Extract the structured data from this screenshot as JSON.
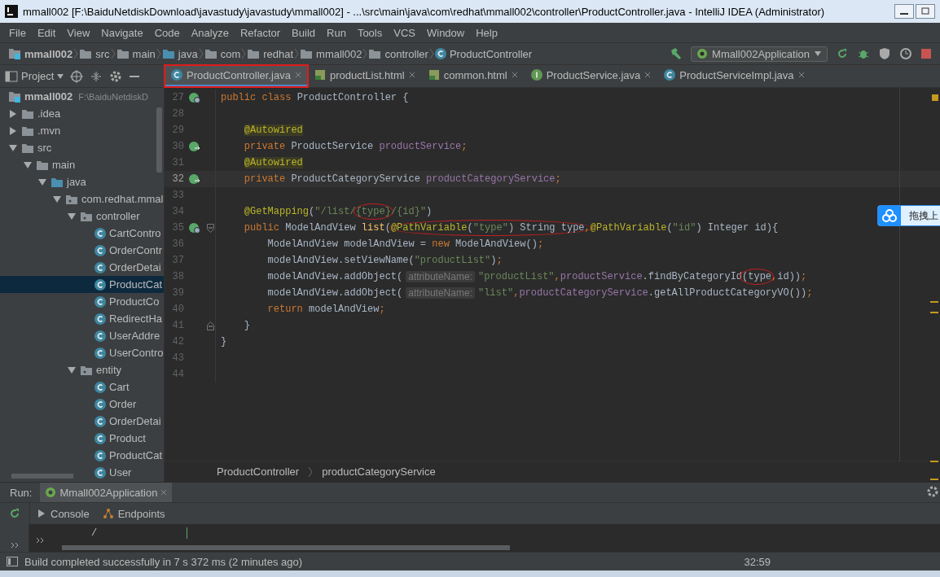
{
  "window": {
    "title": "mmall002 [F:\\BaiduNetdiskDownload\\javastudy\\javastudy\\mmall002] - ...\\src\\main\\java\\com\\redhat\\mmall002\\controller\\ProductController.java - IntelliJ IDEA (Administrator)"
  },
  "menu": [
    "File",
    "Edit",
    "View",
    "Navigate",
    "Code",
    "Analyze",
    "Refactor",
    "Build",
    "Run",
    "Tools",
    "VCS",
    "Window",
    "Help"
  ],
  "breadcrumbs": [
    {
      "label": "mmall002",
      "kind": "project"
    },
    {
      "label": "src",
      "kind": "folder"
    },
    {
      "label": "main",
      "kind": "folder"
    },
    {
      "label": "java",
      "kind": "source"
    },
    {
      "label": "com",
      "kind": "folder"
    },
    {
      "label": "redhat",
      "kind": "folder"
    },
    {
      "label": "mmall002",
      "kind": "folder"
    },
    {
      "label": "controller",
      "kind": "folder"
    },
    {
      "label": "ProductController",
      "kind": "class"
    }
  ],
  "run_config": "Mmall002Application",
  "project_tool": "Project",
  "tabs": [
    {
      "label": "ProductController.java",
      "kind": "class",
      "selected": true,
      "boxed": true
    },
    {
      "label": "productList.html",
      "kind": "html",
      "selected": false,
      "boxed": false
    },
    {
      "label": "common.html",
      "kind": "html",
      "selected": false,
      "boxed": false
    },
    {
      "label": "ProductService.java",
      "kind": "interface",
      "selected": false,
      "boxed": false
    },
    {
      "label": "ProductServiceImpl.java",
      "kind": "class",
      "selected": false,
      "boxed": false
    }
  ],
  "tree": [
    {
      "label": "mmall002",
      "kind": "project",
      "path": "F:\\BaiduNetdiskD",
      "selected": false,
      "children": [
        {
          "label": ".idea",
          "kind": "folder",
          "selected": false,
          "expanded": false
        },
        {
          "label": ".mvn",
          "kind": "folder",
          "selected": false,
          "expanded": false
        },
        {
          "label": "src",
          "kind": "folder",
          "selected": false,
          "expanded": true,
          "children": [
            {
              "label": "main",
              "kind": "folder",
              "selected": false,
              "expanded": true,
              "children": [
                {
                  "label": "java",
                  "kind": "source",
                  "selected": false,
                  "expanded": true,
                  "children": [
                    {
                      "label": "com.redhat.mmal",
                      "kind": "package",
                      "selected": false,
                      "expanded": true,
                      "children": [
                        {
                          "label": "controller",
                          "kind": "package",
                          "selected": false,
                          "expanded": true,
                          "children": [
                            {
                              "label": "CartContro",
                              "kind": "class",
                              "selected": false
                            },
                            {
                              "label": "OrderContr",
                              "kind": "class",
                              "selected": false
                            },
                            {
                              "label": "OrderDetai",
                              "kind": "class",
                              "selected": false
                            },
                            {
                              "label": "ProductCat",
                              "kind": "class",
                              "selected": true
                            },
                            {
                              "label": "ProductCo",
                              "kind": "class",
                              "selected": false
                            },
                            {
                              "label": "RedirectHa",
                              "kind": "class",
                              "selected": false
                            },
                            {
                              "label": "UserAddre",
                              "kind": "class",
                              "selected": false
                            },
                            {
                              "label": "UserContro",
                              "kind": "class",
                              "selected": false
                            }
                          ]
                        },
                        {
                          "label": "entity",
                          "kind": "package",
                          "selected": false,
                          "expanded": true,
                          "children": [
                            {
                              "label": "Cart",
                              "kind": "class",
                              "selected": false
                            },
                            {
                              "label": "Order",
                              "kind": "class",
                              "selected": false
                            },
                            {
                              "label": "OrderDetai",
                              "kind": "class",
                              "selected": false
                            },
                            {
                              "label": "Product",
                              "kind": "class",
                              "selected": false
                            },
                            {
                              "label": "ProductCat",
                              "kind": "class",
                              "selected": false
                            },
                            {
                              "label": "User",
                              "kind": "class",
                              "selected": false
                            }
                          ]
                        }
                      ]
                    }
                  ]
                }
              ]
            }
          ]
        }
      ]
    }
  ],
  "code": [
    {
      "number": "27",
      "gutter": {
        "kind": "web"
      },
      "current": false,
      "tokens": [
        {
          "kind": "kw",
          "text": "public class "
        },
        {
          "kind": "plain",
          "text": "ProductController {"
        }
      ]
    },
    {
      "number": "28",
      "current": false
    },
    {
      "number": "29",
      "current": false,
      "tokens": [
        {
          "kind": "ann",
          "text": "    @Autowired"
        }
      ]
    },
    {
      "number": "30",
      "gutter": {
        "kind": "bean"
      },
      "current": false,
      "tokens": [
        {
          "kind": "kw",
          "text": "    private "
        },
        {
          "kind": "plain",
          "text": "ProductService "
        },
        {
          "kind": "field",
          "text": "productService"
        },
        {
          "kind": "kw",
          "text": ";"
        }
      ]
    },
    {
      "number": "31",
      "current": false,
      "tokens": [
        {
          "kind": "ann",
          "text": "    @Autowired"
        }
      ]
    },
    {
      "number": "32",
      "gutter": {
        "kind": "bean"
      },
      "current": true,
      "tokens": [
        {
          "kind": "kw",
          "text": "    private "
        },
        {
          "kind": "plain",
          "text": "ProductCategoryService "
        },
        {
          "kind": "field",
          "text": "productCategoryService"
        },
        {
          "kind": "kw",
          "text": ";"
        }
      ]
    },
    {
      "number": "33",
      "current": false
    },
    {
      "number": "34",
      "current": false,
      "tokens": [
        {
          "kind": "annplain",
          "text": "    @GetMapping"
        },
        {
          "kind": "plain",
          "text": "("
        },
        {
          "kind": "str",
          "text": "\"/list/"
        },
        {
          "kind": "str",
          "text": "{type}",
          "circled": true
        },
        {
          "kind": "str",
          "text": "/{id}\""
        },
        {
          "kind": "plain",
          "text": ")"
        }
      ]
    },
    {
      "number": "35",
      "gutter": {
        "kind": "web"
      },
      "fold": {
        "kind": "open"
      },
      "current": false,
      "tokens": [
        {
          "kind": "kw",
          "text": "    public "
        },
        {
          "kind": "plain",
          "text": "ModelAndView "
        },
        {
          "kind": "fn",
          "text": "list"
        },
        {
          "kind": "plain",
          "text": "("
        },
        {
          "kind": "group",
          "circled": true,
          "parts": [
            {
              "kind": "annplain",
              "text": "@PathVariable"
            },
            {
              "kind": "plain",
              "text": "("
            },
            {
              "kind": "str",
              "text": "\"type\""
            },
            {
              "kind": "plain",
              "text": ") String type"
            },
            {
              "kind": "kw",
              "text": ","
            }
          ]
        },
        {
          "kind": "annplain",
          "text": "@PathVariable"
        },
        {
          "kind": "plain",
          "text": "("
        },
        {
          "kind": "str",
          "text": "\"id\""
        },
        {
          "kind": "plain",
          "text": ") Integer id){"
        }
      ]
    },
    {
      "number": "36",
      "current": false,
      "tokens": [
        {
          "kind": "plain",
          "text": "        ModelAndView modelAndView = "
        },
        {
          "kind": "kw",
          "text": "new "
        },
        {
          "kind": "plain",
          "text": "ModelAndView()"
        },
        {
          "kind": "kw",
          "text": ";"
        }
      ]
    },
    {
      "number": "37",
      "current": false,
      "tokens": [
        {
          "kind": "plain",
          "text": "        modelAndView.setViewName("
        },
        {
          "kind": "str",
          "text": "\"productList\""
        },
        {
          "kind": "plain",
          "text": ")"
        },
        {
          "kind": "kw",
          "text": ";"
        }
      ]
    },
    {
      "number": "38",
      "current": false,
      "tokens": [
        {
          "kind": "plain",
          "text": "        modelAndView.addObject("
        },
        {
          "kind": "hint",
          "text": "attributeName:"
        },
        {
          "kind": "str",
          "text": "\"productList\""
        },
        {
          "kind": "kw",
          "text": ","
        },
        {
          "kind": "field",
          "text": "productService"
        },
        {
          "kind": "plain",
          "text": ".findByCategoryId"
        },
        {
          "kind": "plain",
          "text": "(type",
          "circled": true
        },
        {
          "kind": "kw",
          "text": ","
        },
        {
          "kind": "plain",
          "text": "id))"
        },
        {
          "kind": "kw",
          "text": ";"
        }
      ]
    },
    {
      "number": "39",
      "current": false,
      "tokens": [
        {
          "kind": "plain",
          "text": "        modelAndView.addObject("
        },
        {
          "kind": "hint",
          "text": "attributeName:"
        },
        {
          "kind": "str",
          "text": "\"list\""
        },
        {
          "kind": "kw",
          "text": ","
        },
        {
          "kind": "field",
          "text": "productCategoryService"
        },
        {
          "kind": "plain",
          "text": ".getAllProductCategoryVO())"
        },
        {
          "kind": "kw",
          "text": ";"
        }
      ]
    },
    {
      "number": "40",
      "current": false,
      "tokens": [
        {
          "kind": "kw",
          "text": "        return "
        },
        {
          "kind": "plain",
          "text": "modelAndView"
        },
        {
          "kind": "kw",
          "text": ";"
        }
      ]
    },
    {
      "number": "41",
      "fold": {
        "kind": "close"
      },
      "current": false,
      "tokens": [
        {
          "kind": "plain",
          "text": "    }"
        }
      ]
    },
    {
      "number": "42",
      "current": false,
      "tokens": [
        {
          "kind": "plain",
          "text": "}"
        }
      ]
    },
    {
      "number": "43",
      "current": false
    },
    {
      "number": "44",
      "current": false
    }
  ],
  "editor_breadcrumbs": [
    "ProductController",
    "productCategoryService"
  ],
  "upload_widget": {
    "label": "拖拽上"
  },
  "run_panel": {
    "label": "Run:",
    "tab": "Mmall002Application",
    "tools": [
      {
        "label": "Console",
        "kind": "console"
      },
      {
        "label": "Endpoints",
        "kind": "endpoints"
      }
    ],
    "console_line": "/"
  },
  "status_bar": {
    "message": "Build completed successfully in 7 s 372 ms (2 minutes ago)",
    "position": "32:59"
  }
}
